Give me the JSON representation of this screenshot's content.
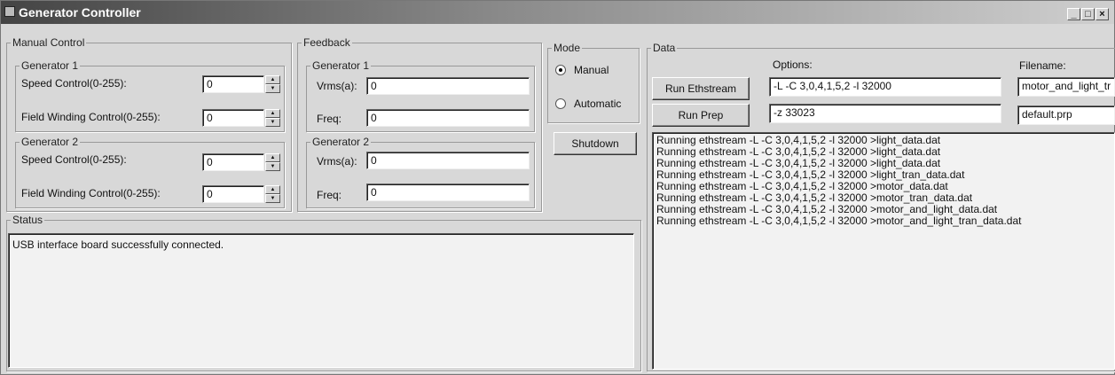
{
  "window": {
    "title": "Generator Controller",
    "minimize": "_",
    "maximize": "□",
    "close": "×"
  },
  "manual_control": {
    "legend": "Manual Control",
    "gen1": {
      "legend": "Generator 1",
      "speed_label": "Speed Control(0-255):",
      "speed_value": "0",
      "field_label": "Field Winding Control(0-255):",
      "field_value": "0"
    },
    "gen2": {
      "legend": "Generator 2",
      "speed_label": "Speed Control(0-255):",
      "speed_value": "0",
      "field_label": "Field Winding Control(0-255):",
      "field_value": "0"
    }
  },
  "feedback": {
    "legend": "Feedback",
    "gen1": {
      "legend": "Generator 1",
      "vrms_label": "Vrms(a):",
      "vrms_value": "0",
      "freq_label": "Freq:",
      "freq_value": "0"
    },
    "gen2": {
      "legend": "Generator 2",
      "vrms_label": "Vrms(a):",
      "vrms_value": "0",
      "freq_label": "Freq:",
      "freq_value": "0"
    }
  },
  "mode": {
    "legend": "Mode",
    "manual_label": "Manual",
    "automatic_label": "Automatic",
    "selected": "Manual"
  },
  "shutdown_label": "Shutdown",
  "data": {
    "legend": "Data",
    "options_label": "Options:",
    "filename_label": "Filename:",
    "run_ethstream_label": "Run Ethstream",
    "run_prep_label": "Run Prep",
    "ethstream_options": "-L -C 3,0,4,1,5,2 -l 32000",
    "prep_options": "-z 33023",
    "ethstream_filename": "motor_and_light_tr",
    "prep_filename": "default.prp",
    "log": [
      "Running ethstream -L -C 3,0,4,1,5,2 -l 32000 >light_data.dat",
      "Running ethstream -L -C 3,0,4,1,5,2 -l 32000 >light_data.dat",
      "Running ethstream -L -C 3,0,4,1,5,2 -l 32000 >light_data.dat",
      "Running ethstream -L -C 3,0,4,1,5,2 -l 32000 >light_tran_data.dat",
      "Running ethstream -L -C 3,0,4,1,5,2 -l 32000 >motor_data.dat",
      "Running ethstream -L -C 3,0,4,1,5,2 -l 32000 >motor_tran_data.dat",
      "Running ethstream -L -C 3,0,4,1,5,2 -l 32000 >motor_and_light_data.dat",
      "Running ethstream -L -C 3,0,4,1,5,2 -l 32000 >motor_and_light_tran_data.dat"
    ]
  },
  "status": {
    "legend": "Status",
    "message": "USB interface board successfully connected."
  }
}
